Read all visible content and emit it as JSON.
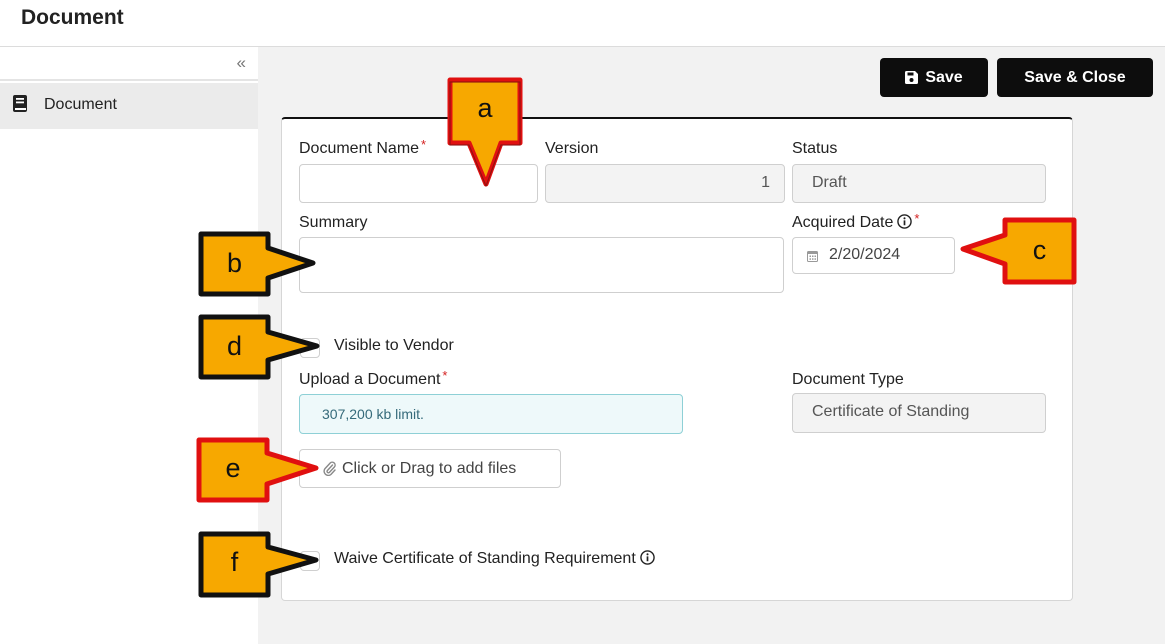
{
  "header": {
    "title": "Document"
  },
  "sidebar": {
    "collapse_icon": "double-chevron-left-icon",
    "items": [
      {
        "label": "Document",
        "icon": "book-icon"
      }
    ]
  },
  "toolbar": {
    "save_label": "Save",
    "save_close_label": "Save & Close"
  },
  "form": {
    "document_name": {
      "label": "Document Name",
      "required": true,
      "value": ""
    },
    "version": {
      "label": "Version",
      "value": "1"
    },
    "status": {
      "label": "Status",
      "value": "Draft"
    },
    "summary": {
      "label": "Summary",
      "value": ""
    },
    "acquired_date": {
      "label": "Acquired Date",
      "required": true,
      "value": "2/20/2024",
      "icon": "calendar-icon"
    },
    "visible_to_vendor": {
      "label": "Visible to Vendor",
      "checked": false
    },
    "upload": {
      "label": "Upload a Document",
      "required": true,
      "limit_text": "307,200 kb limit.",
      "button_label": "Click or Drag to add files",
      "icon": "paperclip-icon"
    },
    "document_type": {
      "label": "Document Type",
      "value": "Certificate of Standing"
    },
    "waive": {
      "label": "Waive Certificate of Standing Requirement",
      "checked": false
    }
  },
  "callouts": {
    "a": "a",
    "b": "b",
    "c": "c",
    "d": "d",
    "e": "e",
    "f": "f"
  },
  "colors": {
    "callout_fill": "#f7a800",
    "callout_border": "#e01010",
    "primary_button": "#0d0d0d",
    "required": "#d42020",
    "info_bg": "#eef9fa"
  }
}
